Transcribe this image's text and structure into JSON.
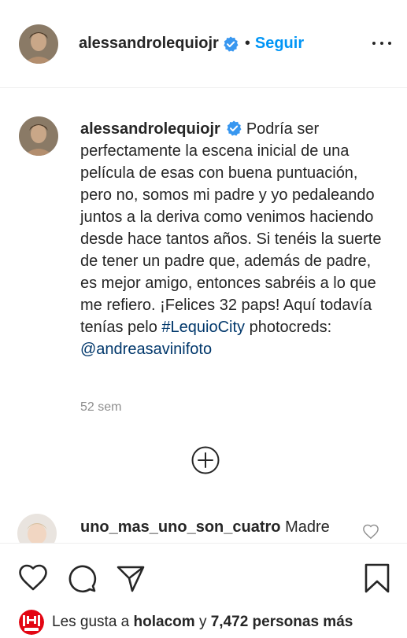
{
  "header": {
    "username": "alessandrolequiojr",
    "separator": "•",
    "follow_label": "Seguir",
    "verified_icon": "verified-badge-icon",
    "more_icon": "more-options-icon"
  },
  "caption": {
    "username": "alessandrolequiojr",
    "text_before_hashtag": "Podría ser perfectamente la escena inicial de una película de esas con buena puntuación, pero no, somos mi padre y yo pedaleando juntos a la deriva como venimos haciendo desde hace tantos años. Si tenéis la suerte de tener un padre que, además de padre, es mejor amigo, entonces sabréis a lo que me refiero. ¡Felices 32 paps! Aquí todavía tenías pelo",
    "hashtag": "#LequioCity",
    "text_after_hashtag": "photocreds:",
    "mention": "@andreasavinifoto",
    "time": "52 sem"
  },
  "comments": [
    {
      "username": "uno_mas_uno_son_cuatro",
      "text": "Madre"
    }
  ],
  "actions": {
    "like_icon": "heart-icon",
    "comment_icon": "comment-icon",
    "share_icon": "share-icon",
    "save_icon": "bookmark-icon",
    "load_more_icon": "plus-circle-icon"
  },
  "likes": {
    "prefix": "Les gusta a",
    "liker": "holacom",
    "conjunction": "y",
    "count": "7,472 personas más",
    "liker_logo_text": "¡HOLA!"
  },
  "colors": {
    "link_blue": "#0095f6",
    "hashtag_blue": "#00376b",
    "muted": "#8e8e8e",
    "verified": "#3897f0"
  }
}
